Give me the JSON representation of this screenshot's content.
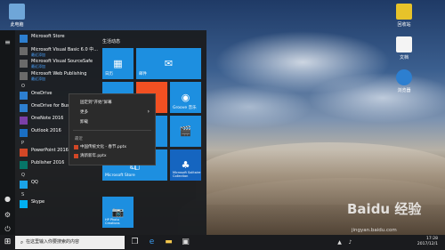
{
  "desktop": {
    "icons": [
      {
        "label": "此电脑"
      },
      {
        "label": "回收站"
      },
      {
        "label": "文档"
      },
      {
        "label": "浏览器"
      }
    ]
  },
  "start_menu": {
    "apps": [
      {
        "label": "Microsoft Store",
        "sub": ""
      },
      {
        "label": "Microsoft Visual Basic 6.0 中...",
        "sub": "最近添加"
      },
      {
        "label": "Microsoft Visual SourceSafe",
        "sub": "最近添加"
      },
      {
        "label": "Microsoft Web Publishing",
        "sub": "最近添加"
      },
      {
        "label": "O",
        "sub": "",
        "letter": true
      },
      {
        "label": "OneDrive",
        "sub": ""
      },
      {
        "label": "OneDrive for Business",
        "sub": ""
      },
      {
        "label": "OneNote 2016",
        "sub": ""
      },
      {
        "label": "Outlook 2016",
        "sub": ""
      },
      {
        "label": "P",
        "sub": "",
        "letter": true
      },
      {
        "label": "PowerPoint 2016",
        "sub": ""
      },
      {
        "label": "Publisher 2016",
        "sub": ""
      },
      {
        "label": "Q",
        "sub": "",
        "letter": true
      },
      {
        "label": "QQ",
        "sub": ""
      },
      {
        "label": "S",
        "sub": "",
        "letter": true
      },
      {
        "label": "Skype",
        "sub": ""
      }
    ],
    "tiles_section": "生活动态",
    "tiles": [
      {
        "label": "日历",
        "glyph": "▦"
      },
      {
        "label": "邮件",
        "glyph": "✉"
      },
      {
        "label": "",
        "glyph": "▭"
      },
      {
        "label": "",
        "glyph": "⊙"
      },
      {
        "label": "Groove 音乐",
        "glyph": "◉"
      },
      {
        "label": "",
        "glyph": "▮"
      },
      {
        "label": "",
        "glyph": "✔"
      },
      {
        "label": "",
        "glyph": "🎬"
      },
      {
        "label": "Microsoft Store",
        "glyph": "🛍"
      },
      {
        "label": "Microsoft Solitaire Collection",
        "glyph": "♣"
      },
      {
        "label": "HP Photo Creations",
        "glyph": "📷"
      }
    ]
  },
  "context_menu": {
    "items": [
      "固定到\"开始\"屏幕",
      "更多",
      "卸载"
    ],
    "recent_header": "最近",
    "recent": [
      "中国传统文化 - 春节.pptx",
      "清新新年.pptx"
    ]
  },
  "taskbar": {
    "search_placeholder": "在这里输入你要搜索的内容",
    "time": "17:28",
    "date": "2017/12/1"
  },
  "watermark": {
    "brand": "Baidu 经验",
    "url": "jingyan.baidu.com"
  }
}
